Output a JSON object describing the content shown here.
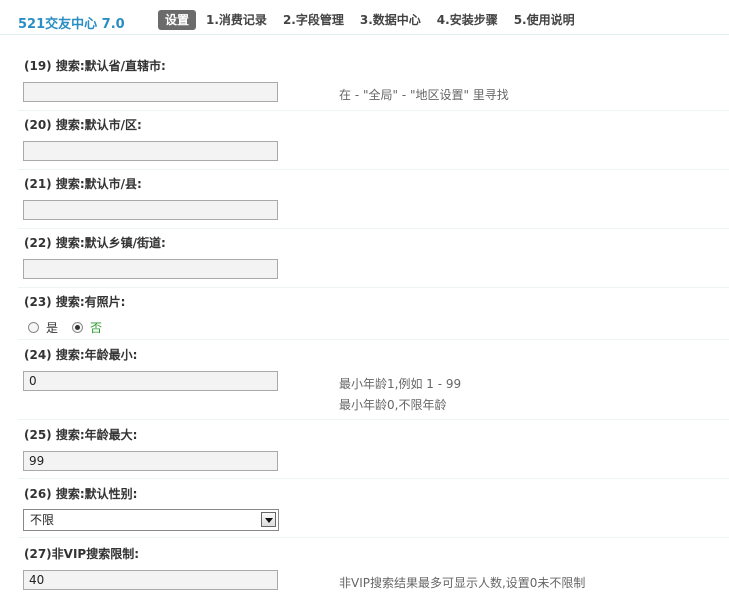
{
  "header": {
    "brand": "521交友中心 7.0",
    "tabs": [
      {
        "label": "设置",
        "active": true
      },
      {
        "label": "1.消费记录"
      },
      {
        "label": "2.字段管理"
      },
      {
        "label": "3.数据中心"
      },
      {
        "label": "4.安装步骤"
      },
      {
        "label": "5.使用说明"
      }
    ]
  },
  "fields": {
    "f19": {
      "label": "(19) 搜索:默认省/直辖市:",
      "value": "",
      "hint": "在 - \"全局\" - \"地区设置\" 里寻找"
    },
    "f20": {
      "label": "(20) 搜索:默认市/区:",
      "value": ""
    },
    "f21": {
      "label": "(21) 搜索:默认市/县:",
      "value": ""
    },
    "f22": {
      "label": "(22) 搜索:默认乡镇/街道:",
      "value": ""
    },
    "f23": {
      "label": "(23) 搜索:有照片:",
      "options": [
        "是",
        "否"
      ],
      "selected": "否"
    },
    "f24": {
      "label": "(24) 搜索:年龄最小:",
      "value": "0",
      "hint1": "最小年龄1,例如 1 - 99",
      "hint2": "最小年龄0,不限年龄"
    },
    "f25": {
      "label": "(25) 搜索:年龄最大:",
      "value": "99"
    },
    "f26": {
      "label": "(26) 搜索:默认性别:",
      "value": "不限"
    },
    "f27": {
      "label": "(27)非VIP搜索限制:",
      "value": "40",
      "hint": "非VIP搜索结果最多可显示人数,设置0未不限制"
    }
  },
  "colors": {
    "brand": "#2a8ec4",
    "active_tab": "#6b6b6b",
    "selected_radio": "#2a9b2a"
  }
}
